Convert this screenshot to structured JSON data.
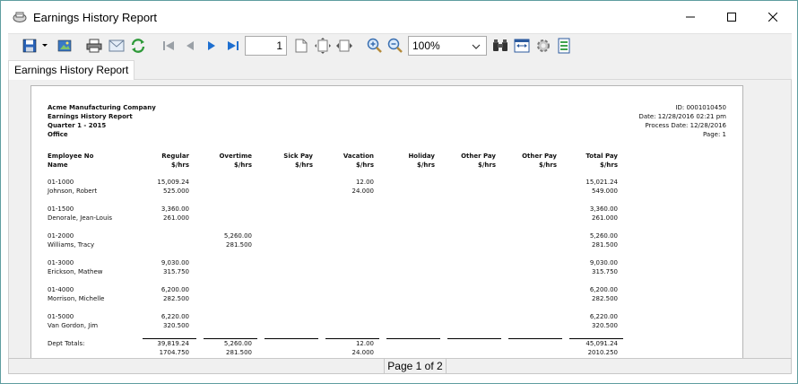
{
  "window": {
    "title": "Earnings History Report"
  },
  "toolbar": {
    "page_number": "1",
    "zoom": "100%"
  },
  "tabs": [
    {
      "label": "Earnings History Report"
    }
  ],
  "report": {
    "header": {
      "company": "Acme Manufacturing Company",
      "title": "Earnings History Report",
      "period": "Quarter 1 - 2015",
      "department": "Office",
      "id": "ID: 0001010450",
      "date": "Date: 12/28/2016 02:21 pm",
      "process_date": "Process Date: 12/28/2016",
      "page": "Page: 1"
    },
    "columns": [
      {
        "line1": "Employee No",
        "line2": "Name"
      },
      {
        "line1": "Regular",
        "line2": "$/hrs"
      },
      {
        "line1": "Overtime",
        "line2": "$/hrs"
      },
      {
        "line1": "Sick Pay",
        "line2": "$/hrs"
      },
      {
        "line1": "Vacation",
        "line2": "$/hrs"
      },
      {
        "line1": "Holiday",
        "line2": "$/hrs"
      },
      {
        "line1": "Other Pay",
        "line2": "$/hrs"
      },
      {
        "line1": "Other Pay",
        "line2": "$/hrs"
      },
      {
        "line1": "Total Pay",
        "line2": "$/hrs"
      }
    ],
    "employees": [
      {
        "no": "01-1000",
        "name": "Johnson, Robert",
        "regular": [
          "15,009.24",
          "525.000"
        ],
        "overtime": [
          "",
          ""
        ],
        "vacation": [
          "12.00",
          "24.000"
        ],
        "total": [
          "15,021.24",
          "549.000"
        ]
      },
      {
        "no": "01-1500",
        "name": "Denorale, Jean-Louis",
        "regular": [
          "3,360.00",
          "261.000"
        ],
        "overtime": [
          "",
          ""
        ],
        "vacation": [
          "",
          ""
        ],
        "total": [
          "3,360.00",
          "261.000"
        ]
      },
      {
        "no": "01-2000",
        "name": "Williams, Tracy",
        "regular": [
          "",
          ""
        ],
        "overtime": [
          "5,260.00",
          "281.500"
        ],
        "vacation": [
          "",
          ""
        ],
        "total": [
          "5,260.00",
          "281.500"
        ]
      },
      {
        "no": "01-3000",
        "name": "Erickson, Mathew",
        "regular": [
          "9,030.00",
          "315.750"
        ],
        "overtime": [
          "",
          ""
        ],
        "vacation": [
          "",
          ""
        ],
        "total": [
          "9,030.00",
          "315.750"
        ]
      },
      {
        "no": "01-4000",
        "name": "Morrison, Michelle",
        "regular": [
          "6,200.00",
          "282.500"
        ],
        "overtime": [
          "",
          ""
        ],
        "vacation": [
          "",
          ""
        ],
        "total": [
          "6,200.00",
          "282.500"
        ]
      },
      {
        "no": "01-5000",
        "name": "Van Gordon, Jim",
        "regular": [
          "6,220.00",
          "320.500"
        ],
        "overtime": [
          "",
          ""
        ],
        "vacation": [
          "",
          ""
        ],
        "total": [
          "6,220.00",
          "320.500"
        ]
      }
    ],
    "totals": {
      "label": "Dept Totals:",
      "regular": [
        "39,819.24",
        "1704.750"
      ],
      "overtime": [
        "5,260.00",
        "281.500"
      ],
      "vacation": [
        "12.00",
        "24.000"
      ],
      "total": [
        "45,091.24",
        "2010.250"
      ]
    }
  },
  "status": {
    "page_of": "Page 1 of 2"
  }
}
